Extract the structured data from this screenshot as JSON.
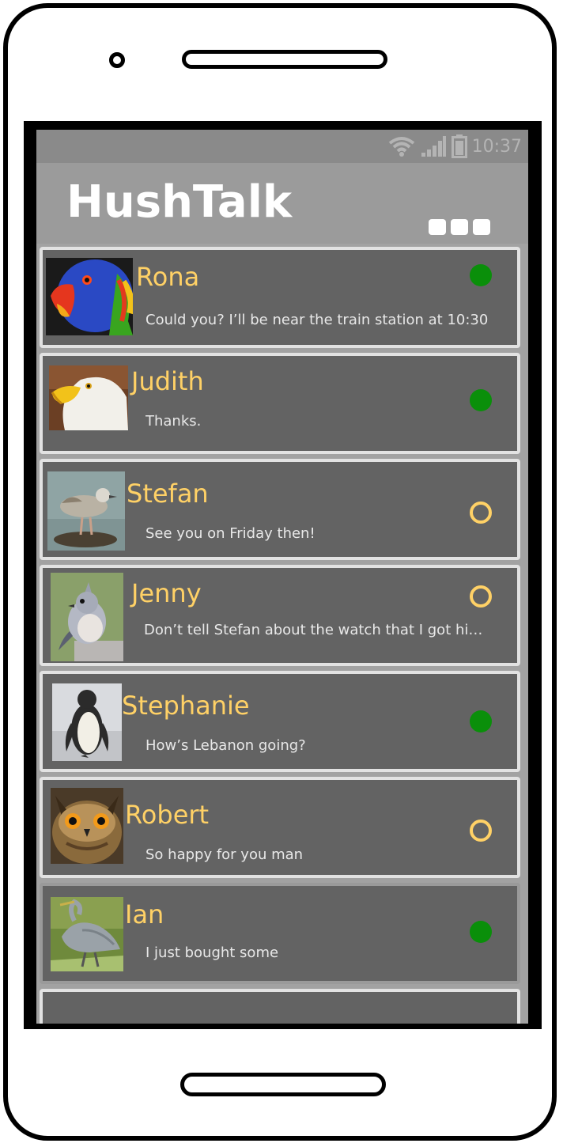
{
  "status_bar": {
    "time": "10:37"
  },
  "app": {
    "title": "HushTalk",
    "menu_icon": "more-dots-icon"
  },
  "colors": {
    "accent_name": "#ffd166",
    "online": "#0a8f0a",
    "card_bg": "#636363",
    "app_bar_bg": "#9b9b9b"
  },
  "contacts": [
    {
      "name": "Rona",
      "message": "Could you? I’ll be near the train station at 10:30",
      "status": "online",
      "avatar": "parrot-avatar"
    },
    {
      "name": "Judith",
      "message": "Thanks.",
      "status": "online",
      "avatar": "eagle-avatar"
    },
    {
      "name": "Stefan",
      "message": "See you on Friday then!",
      "status": "offline",
      "avatar": "gull-avatar"
    },
    {
      "name": "Jenny",
      "message": "Don’t tell Stefan about the watch that I got him u...",
      "status": "offline",
      "avatar": "titmouse-avatar"
    },
    {
      "name": "Stephanie",
      "message": "How’s Lebanon going?",
      "status": "online",
      "avatar": "penguin-avatar"
    },
    {
      "name": "Robert",
      "message": "So happy for you man",
      "status": "offline",
      "avatar": "owl-avatar"
    },
    {
      "name": "Ian",
      "message": "I just bought some",
      "status": "online",
      "avatar": "heron-avatar"
    }
  ]
}
